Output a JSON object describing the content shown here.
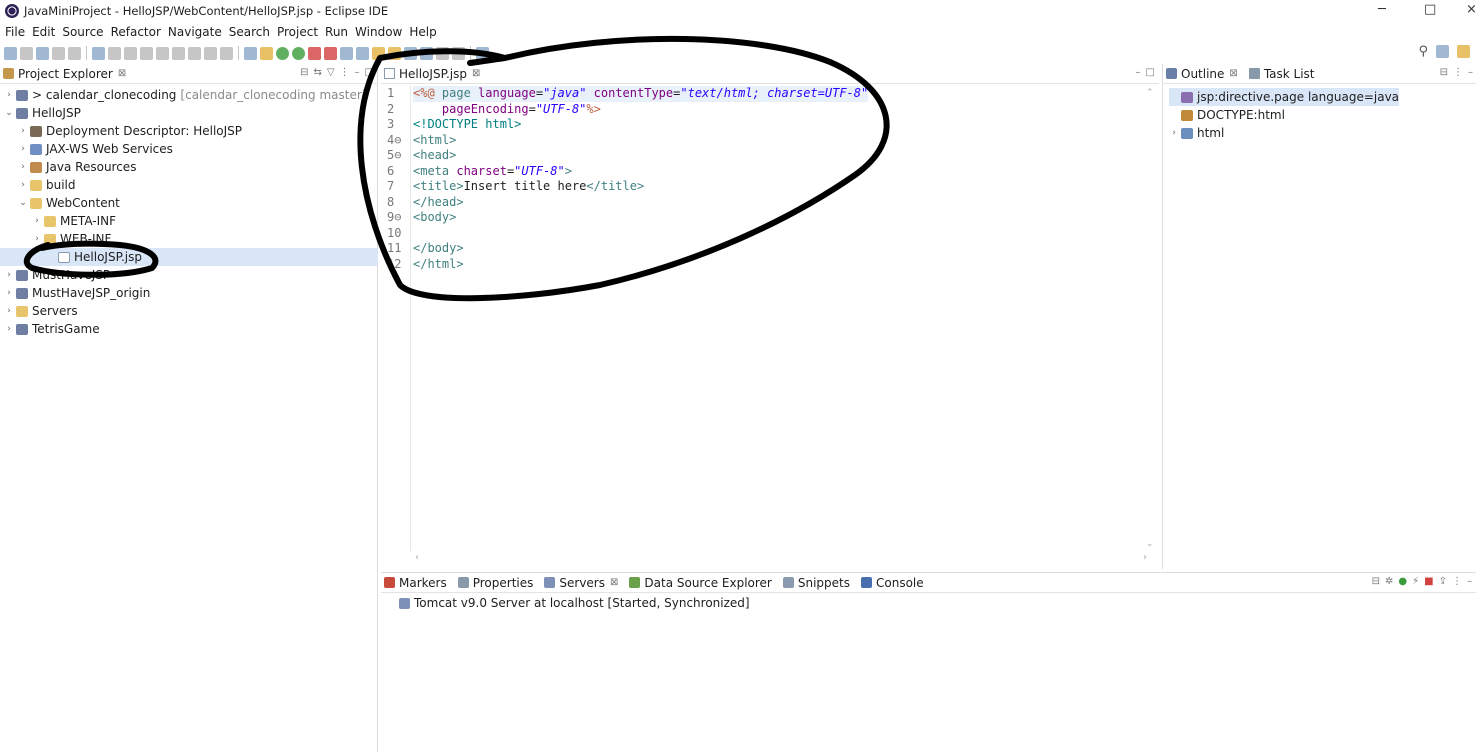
{
  "window": {
    "title": "JavaMiniProject - HelloJSP/WebContent/HelloJSP.jsp - Eclipse IDE",
    "minimize": "─",
    "maximize": "□",
    "close": "×"
  },
  "menu": [
    "File",
    "Edit",
    "Source",
    "Refactor",
    "Navigate",
    "Search",
    "Project",
    "Run",
    "Window",
    "Help"
  ],
  "explorer": {
    "tab_label": "Project Explorer",
    "tree": [
      {
        "label": "> calendar_clonecoding",
        "suffix": "[calendar_clonecoding master]",
        "twisty": "›",
        "indent": 0,
        "icon": "project-icon"
      },
      {
        "label": "HelloJSP",
        "suffix": "",
        "twisty": "⌄",
        "indent": 0,
        "icon": "project-icon"
      },
      {
        "label": "Deployment Descriptor: HelloJSP",
        "suffix": "",
        "twisty": "›",
        "indent": 1,
        "icon": "deployment-descriptor-icon"
      },
      {
        "label": "JAX-WS Web Services",
        "suffix": "",
        "twisty": "›",
        "indent": 1,
        "icon": "web-services-icon"
      },
      {
        "label": "Java Resources",
        "suffix": "",
        "twisty": "›",
        "indent": 1,
        "icon": "java-resources-icon"
      },
      {
        "label": "build",
        "suffix": "",
        "twisty": "›",
        "indent": 1,
        "icon": "folder-icon"
      },
      {
        "label": "WebContent",
        "suffix": "",
        "twisty": "⌄",
        "indent": 1,
        "icon": "folder-icon"
      },
      {
        "label": "META-INF",
        "suffix": "",
        "twisty": "›",
        "indent": 2,
        "icon": "folder-icon"
      },
      {
        "label": "WEB-INF",
        "suffix": "",
        "twisty": "›",
        "indent": 2,
        "icon": "folder-icon"
      },
      {
        "label": "HelloJSP.jsp",
        "suffix": "",
        "twisty": "",
        "indent": 3,
        "icon": "jsp-file-icon"
      },
      {
        "label": "MustHaveJSP",
        "suffix": "",
        "twisty": "›",
        "indent": 0,
        "icon": "project-icon"
      },
      {
        "label": "MustHaveJSP_origin",
        "suffix": "",
        "twisty": "›",
        "indent": 0,
        "icon": "project-icon"
      },
      {
        "label": "Servers",
        "suffix": "",
        "twisty": "›",
        "indent": 0,
        "icon": "folder-icon"
      },
      {
        "label": "TetrisGame",
        "suffix": "",
        "twisty": "›",
        "indent": 0,
        "icon": "project-icon"
      }
    ]
  },
  "editor": {
    "tab_label": "HelloJSP.jsp",
    "line_numbers": [
      "1",
      "2",
      "3",
      "4⊖",
      "5⊖",
      "6",
      "7",
      "8",
      "9⊖",
      "10",
      "11",
      "12"
    ],
    "lines": [
      [
        {
          "t": "<%@",
          "c": "jsp"
        },
        {
          "t": " page ",
          "c": "kw"
        },
        {
          "t": "language",
          "c": "attr"
        },
        {
          "t": "=",
          "c": ""
        },
        {
          "t": "\"java\"",
          "c": "str"
        },
        {
          "t": " contentType",
          "c": "attr"
        },
        {
          "t": "=",
          "c": ""
        },
        {
          "t": "\"text/html; charset=UTF-8\"",
          "c": "str"
        }
      ],
      [
        {
          "t": "    pageEncoding",
          "c": "attr"
        },
        {
          "t": "=",
          "c": ""
        },
        {
          "t": "\"UTF-8\"",
          "c": "str"
        },
        {
          "t": "%>",
          "c": "jsp"
        }
      ],
      [
        {
          "t": "<!DOCTYPE html>",
          "c": "dt"
        }
      ],
      [
        {
          "t": "<html>",
          "c": "kw"
        }
      ],
      [
        {
          "t": "<head>",
          "c": "kw"
        }
      ],
      [
        {
          "t": "<meta ",
          "c": "kw"
        },
        {
          "t": "charset",
          "c": "attr"
        },
        {
          "t": "=",
          "c": ""
        },
        {
          "t": "\"UTF-8\"",
          "c": "str"
        },
        {
          "t": ">",
          "c": "kw"
        }
      ],
      [
        {
          "t": "<title>",
          "c": "kw"
        },
        {
          "t": "Insert title here",
          "c": ""
        },
        {
          "t": "</title>",
          "c": "kw"
        }
      ],
      [
        {
          "t": "</head>",
          "c": "kw"
        }
      ],
      [
        {
          "t": "<body>",
          "c": "kw"
        }
      ],
      [
        {
          "t": "",
          "c": ""
        }
      ],
      [
        {
          "t": "</body>",
          "c": "kw"
        }
      ],
      [
        {
          "t": "</html>",
          "c": "kw"
        }
      ]
    ]
  },
  "outline": {
    "tab_label": "Outline",
    "tab2_label": "Task List",
    "items": [
      {
        "label": "jsp:directive.page language=java",
        "twisty": "",
        "icon": "directive-icon"
      },
      {
        "label": "DOCTYPE:html",
        "twisty": "",
        "icon": "doctype-icon"
      },
      {
        "label": "html",
        "twisty": "›",
        "icon": "html-element-icon"
      }
    ]
  },
  "bottom": {
    "tabs": [
      "Markers",
      "Properties",
      "Servers",
      "Data Source Explorer",
      "Snippets",
      "Console"
    ],
    "active_tab": "Servers",
    "server_row": "Tomcat v9.0 Server at localhost  [Started, Synchronized]"
  },
  "colors": {
    "annotation_ink": "#000000",
    "selection": "#d9e6f7"
  }
}
